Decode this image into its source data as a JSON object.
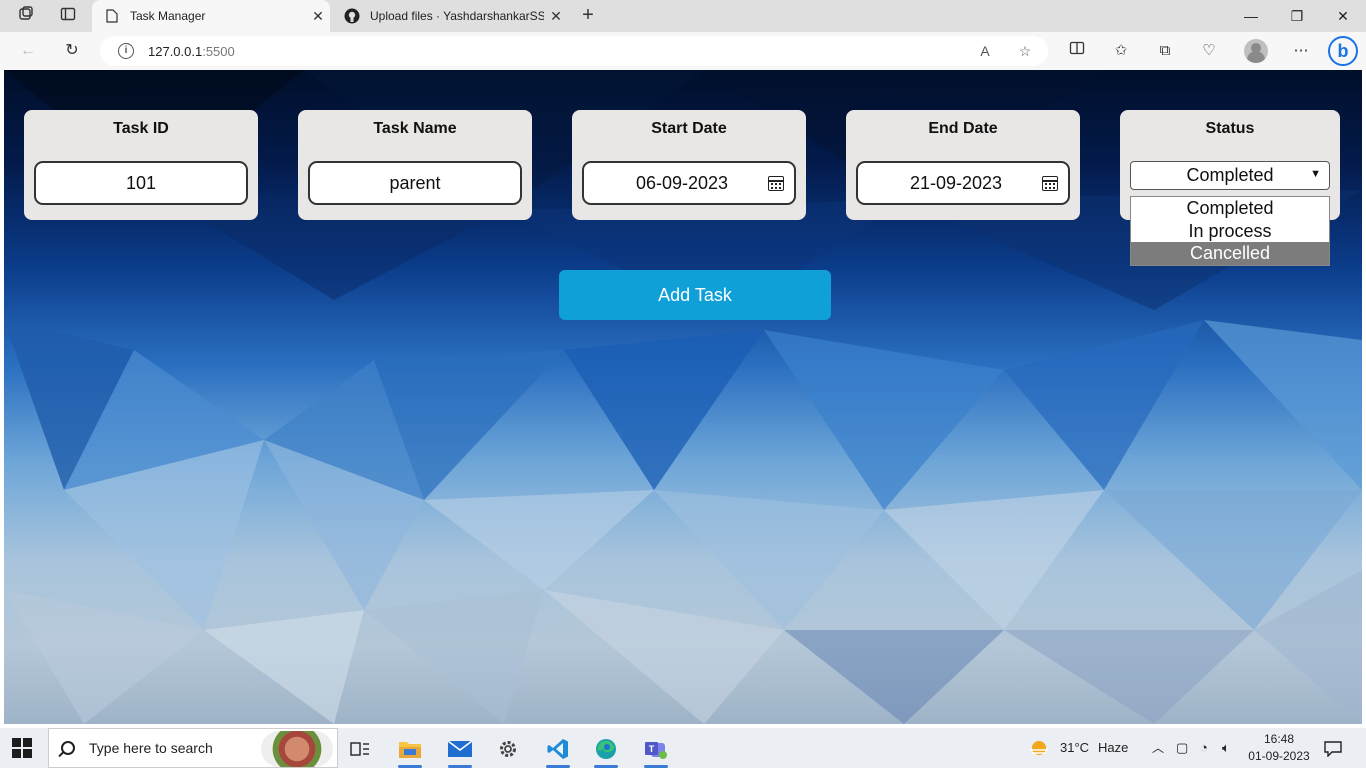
{
  "browser": {
    "tabs": [
      {
        "title": "Task Manager",
        "active": true
      },
      {
        "title": "Upload files · YashdarshankarSS/",
        "active": false
      }
    ],
    "address": {
      "host": "127.0.0.1",
      "port": ":5500"
    }
  },
  "form": {
    "task_id": {
      "label": "Task ID",
      "value": "101"
    },
    "task_name": {
      "label": "Task Name",
      "value": "parent"
    },
    "start_date": {
      "label": "Start Date",
      "value": "06-09-2023"
    },
    "end_date": {
      "label": "End Date",
      "value": "21-09-2023"
    },
    "status": {
      "label": "Status",
      "value": "Completed",
      "options": [
        "Completed",
        "In process",
        "Cancelled"
      ],
      "highlighted": "Cancelled"
    },
    "add_button": "Add Task"
  },
  "taskbar": {
    "search_placeholder": "Type here to search",
    "weather": {
      "temp": "31°C",
      "condition": "Haze"
    },
    "time": "16:48",
    "date": "01-09-2023"
  }
}
